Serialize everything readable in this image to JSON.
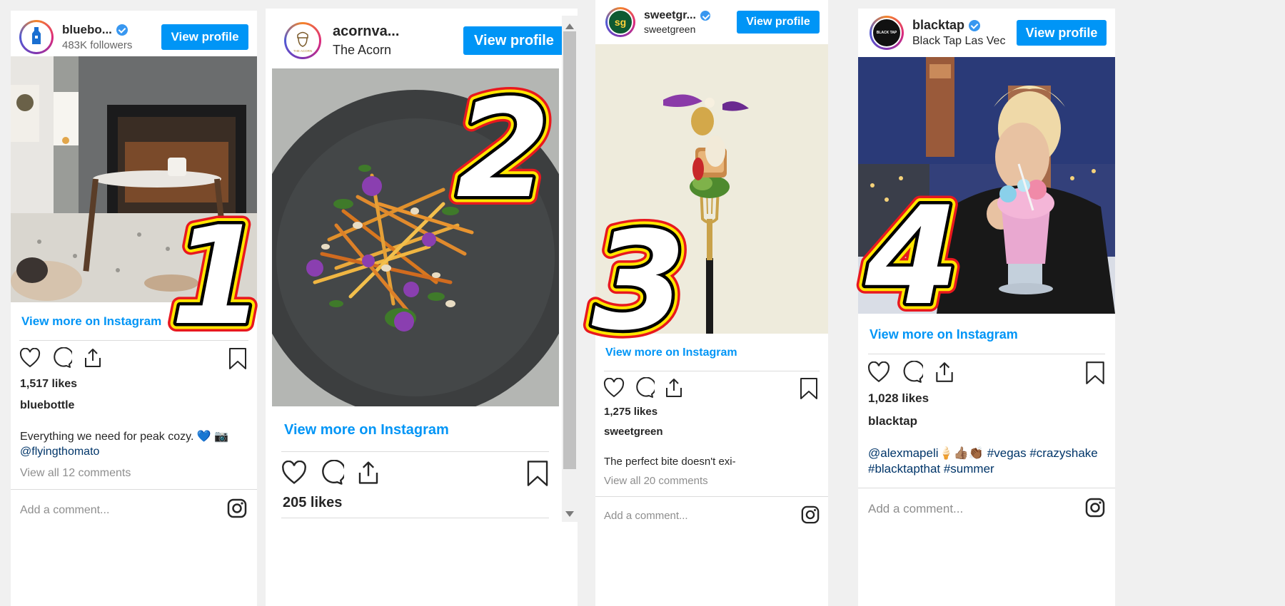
{
  "posts": [
    {
      "number": "1",
      "username": "bluebo...",
      "subtitle": "483K followers",
      "view_profile": "View profile",
      "view_more": "View more on Instagram",
      "likes": "1,517 likes",
      "author": "bluebottle",
      "caption": "Everything we need for peak cozy. 💙 📷",
      "caption_link": "@flyingthomato",
      "comments": "View all 12 comments",
      "add_comment": "Add a comment...",
      "avatar_icon": "bottle-logo-icon"
    },
    {
      "number": "2",
      "username": "acornva...",
      "subtitle": "The Acorn",
      "view_profile": "View profile",
      "view_more": "View more on Instagram",
      "likes": "205 likes",
      "avatar_icon": "acorn-logo-icon",
      "avatar_text": "THE ACORN"
    },
    {
      "number": "3",
      "username": "sweetgr...",
      "subtitle": "sweetgreen",
      "view_profile": "View profile",
      "view_more": "View more on Instagram",
      "likes": "1,275 likes",
      "author": "sweetgreen",
      "caption": "The perfect bite doesn't exi-",
      "comments": "View all 20 comments",
      "add_comment": "Add a comment...",
      "avatar_text": "sg"
    },
    {
      "number": "4",
      "username": "blacktap",
      "subtitle": "Black Tap Las Vec",
      "view_profile": "View profile",
      "view_more": "View more on Instagram",
      "likes": "1,028 likes",
      "author": "blacktap",
      "caption_link": "@alexmapeli",
      "caption_emoji": "🍦👍🏽👏🏾",
      "caption_tags": "#vegas #crazyshake #blacktapthat #summer",
      "add_comment": "Add a comment...",
      "avatar_text": "BLACK TAP"
    }
  ],
  "colors": {
    "button": "#0095f6",
    "badge_fill": "#ffffff",
    "badge_outline": "#000000",
    "badge_glow": "#ffe600",
    "badge_edge": "#e8181e"
  }
}
